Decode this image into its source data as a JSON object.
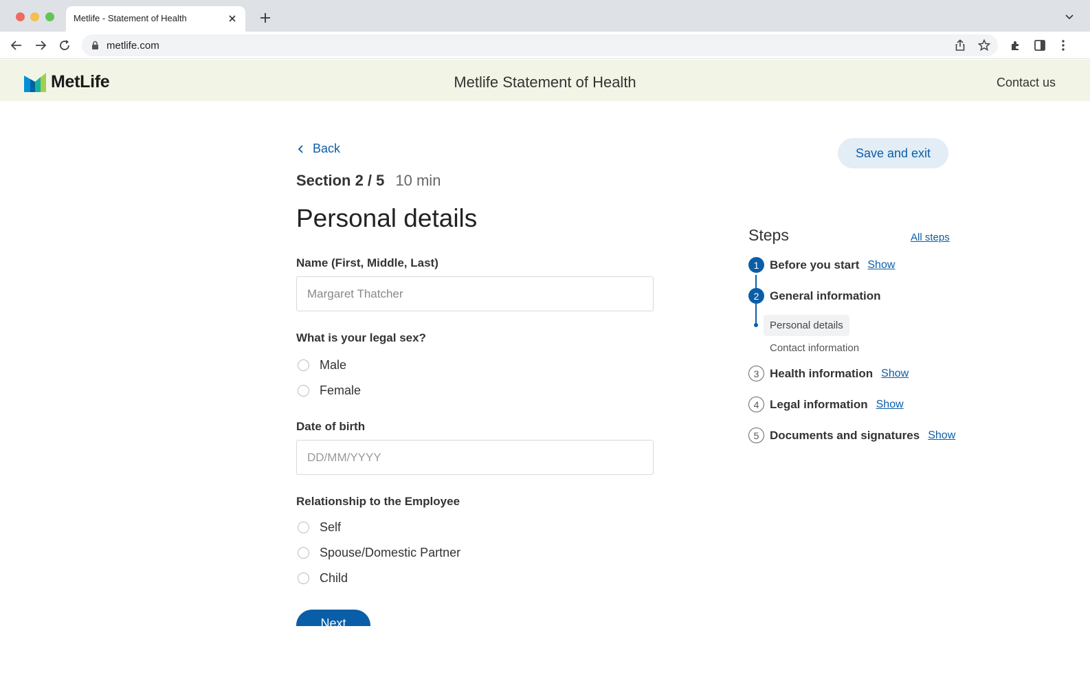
{
  "browser": {
    "tab_title": "Metlife - Statement of Health",
    "url": "metlife.com"
  },
  "site": {
    "logo_text": "MetLife",
    "title": "Metlife Statement of Health",
    "contact": "Contact us"
  },
  "form": {
    "back": "Back",
    "save_exit": "Save and exit",
    "section": "Section 2 / 5",
    "time": "10 min",
    "title": "Personal details",
    "name_label": "Name (First, Middle, Last)",
    "name_value": "Margaret Thatcher",
    "sex_label": "What is your legal sex?",
    "sex_options": [
      "Male",
      "Female"
    ],
    "dob_label": "Date of birth",
    "dob_placeholder": "DD/MM/YYYY",
    "relationship_label": "Relationship to the Employee",
    "relationship_options": [
      "Self",
      "Spouse/Domestic Partner",
      "Child"
    ],
    "next": "Next"
  },
  "steps": {
    "title": "Steps",
    "all_steps": "All steps",
    "items": [
      {
        "num": "1",
        "label": "Before you start",
        "show": "Show"
      },
      {
        "num": "2",
        "label": "General information"
      },
      {
        "num": "3",
        "label": "Health information",
        "show": "Show"
      },
      {
        "num": "4",
        "label": "Legal information",
        "show": "Show"
      },
      {
        "num": "5",
        "label": "Documents and signatures",
        "show": "Show"
      }
    ],
    "substeps": [
      "Personal details",
      "Contact information"
    ]
  },
  "colors": {
    "brand_blue": "#0a5ea8",
    "header_bg": "#f2f5e6"
  }
}
